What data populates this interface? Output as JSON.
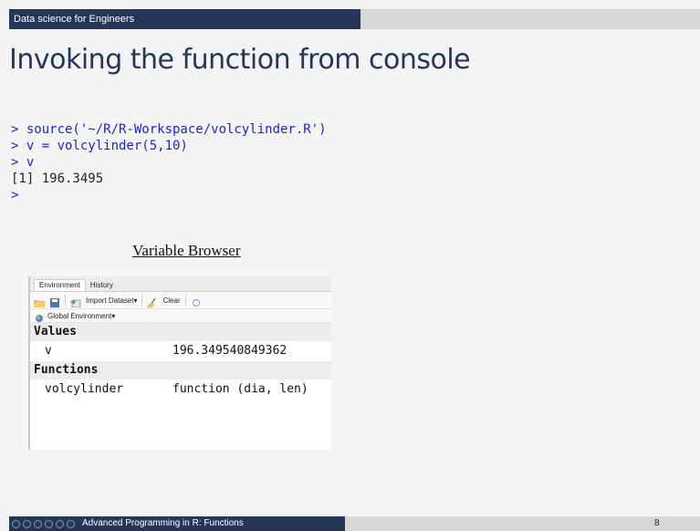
{
  "header": {
    "course_title": "Data science for Engineers"
  },
  "slide": {
    "title": "Invoking the function from console"
  },
  "console": {
    "lines": [
      {
        "text": "> source('~/R/R-Workspace/volcylinder.R')",
        "kind": "command"
      },
      {
        "text": "> v = volcylinder(5,10)",
        "kind": "command"
      },
      {
        "text": "> v",
        "kind": "command"
      },
      {
        "text": "[1] 196.3495",
        "kind": "output"
      },
      {
        "text": ">",
        "kind": "command"
      }
    ]
  },
  "variable_browser": {
    "caption": "Variable Browser",
    "tabs": [
      "Environment",
      "History"
    ],
    "toolbar": {
      "import_label": "Import Dataset",
      "clear_label": "Clear"
    },
    "env_selector": "Global Environment",
    "values_header": "Values",
    "values": [
      {
        "name": "v",
        "value": "196.349540849362"
      }
    ],
    "functions_header": "Functions",
    "functions": [
      {
        "name": "volcylinder",
        "value": "function (dia, len)"
      }
    ]
  },
  "footer": {
    "lecture_title": "Advanced Programming in R: Functions",
    "page_number": "8"
  },
  "colors": {
    "header_bg": "#26355a",
    "title_color": "#26355a",
    "command_color": "#1a22d6",
    "slide_bg": "#f4f4f4"
  }
}
